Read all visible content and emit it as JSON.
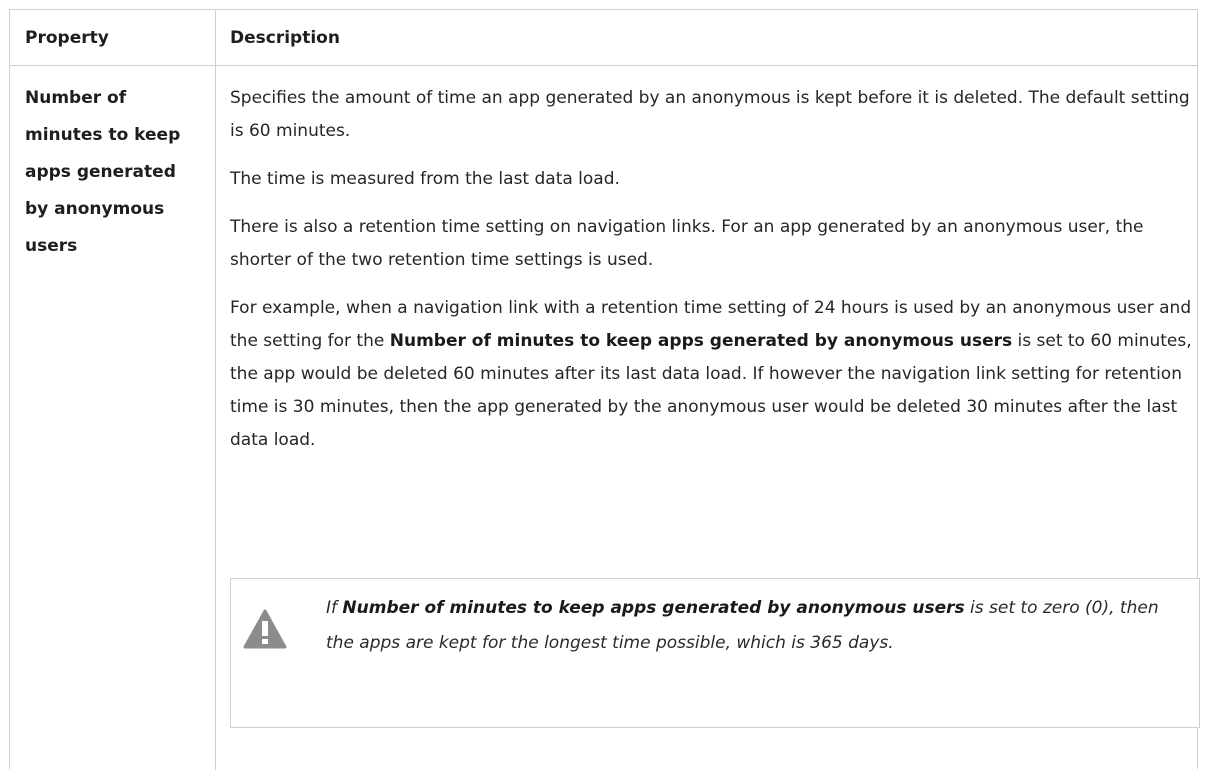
{
  "table": {
    "headers": {
      "property": "Property",
      "description": "Description"
    },
    "row": {
      "property": "Number of minutes to keep apps generated by anonymous users",
      "p1": "Specifies the amount of time an app generated by an anonymous is kept before it is deleted. The default setting is 60 minutes.",
      "p2": "The time is measured from the last data load.",
      "p3": "There is also a retention time setting on navigation links. For an app generated by an anonymous user, the shorter of the two retention time settings is used.",
      "p4_before": "For example, when a navigation link with a retention time setting of 24 hours is used by an anonymous user and the setting for the ",
      "p4_bold": "Number of minutes to keep apps generated by anonymous users",
      "p4_after": " is set to 60 minutes, the app would be deleted 60 minutes after its last data load. If however the navigation link setting for retention time is 30 minutes, then the app generated by the anonymous user would be deleted 30 minutes after the last data load.",
      "note": {
        "icon": "warning-icon",
        "before": "If ",
        "bold": "Number of minutes to keep apps generated by anonymous users",
        "after": " is set to zero (0), then the apps are kept for the longest time possible, which is 365 days."
      }
    }
  },
  "colors": {
    "border": "#cfcfcf",
    "icon": "#8c8c8c"
  }
}
